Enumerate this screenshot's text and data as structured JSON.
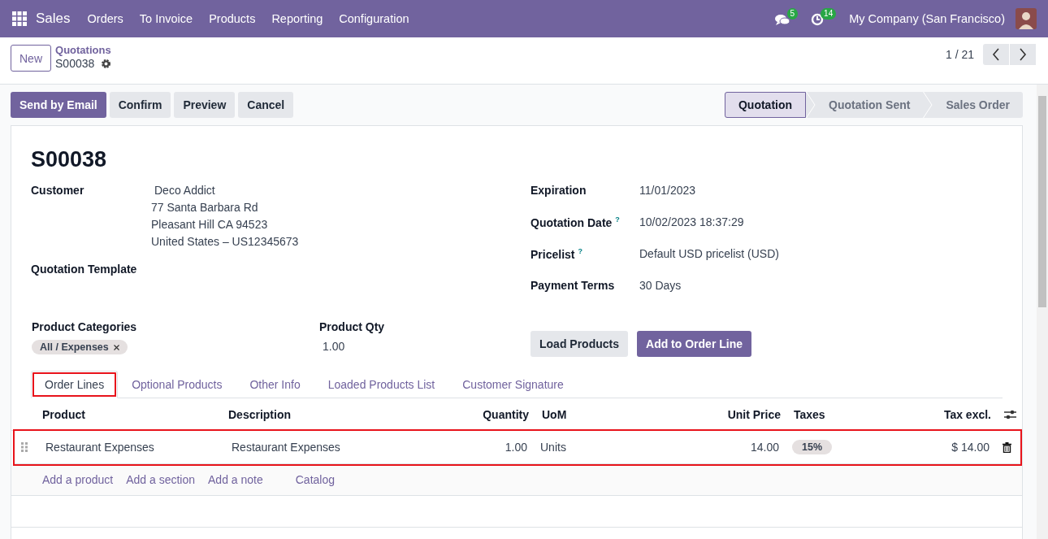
{
  "navbar": {
    "app": "Sales",
    "menu": [
      "Orders",
      "To Invoice",
      "Products",
      "Reporting",
      "Configuration"
    ],
    "messages_count": "5",
    "activities_count": "14",
    "company": "My Company (San Francisco)"
  },
  "control_panel": {
    "new_button": "New",
    "breadcrumb": "Quotations",
    "record": "S00038",
    "pager": "1 / 21"
  },
  "actions": [
    {
      "label": "Send by Email",
      "primary": true
    },
    {
      "label": "Confirm",
      "primary": false
    },
    {
      "label": "Preview",
      "primary": false
    },
    {
      "label": "Cancel",
      "primary": false
    }
  ],
  "status_stages": [
    {
      "label": "Quotation",
      "selected": true
    },
    {
      "label": "Quotation Sent",
      "selected": false
    },
    {
      "label": "Sales Order",
      "selected": false
    }
  ],
  "sheet": {
    "title": "S00038",
    "customer": {
      "label": "Customer",
      "name": "Deco Addict",
      "address": [
        "77 Santa Barbara Rd",
        "Pleasant Hill CA 94523",
        "United States – US12345673"
      ]
    },
    "template_label": "Quotation Template",
    "right_fields": [
      {
        "label": "Expiration",
        "value": "11/01/2023"
      },
      {
        "label": "Quotation Date $^{?}$",
        "value": "10/02/2023 18:37:29"
      },
      {
        "label": "Pricelist $^{?}$",
        "value": "Default USD pricelist (USD)"
      },
      {
        "label": "Payment Terms",
        "value": "30 Days"
      }
    ],
    "categories_label": "Product Categories",
    "category_tag": "All / Expenses",
    "qty_label": "Product Qty",
    "qty_value": "1.00",
    "buttons": [
      {
        "label": "Load Products",
        "primary": false
      },
      {
        "label": "Add to Order Line",
        "primary": true
      }
    ]
  },
  "tabs": [
    {
      "label": "Order Lines",
      "selected": true,
      "highlighted": true
    },
    {
      "label": "Optional Products",
      "selected": false,
      "highlighted": false
    },
    {
      "label": "Other Info",
      "selected": false,
      "highlighted": false
    },
    {
      "label": "Loaded Products List",
      "selected": false,
      "highlighted": false
    },
    {
      "label": "Customer Signature",
      "selected": false,
      "highlighted": false
    }
  ],
  "table": {
    "columns": [
      "Product",
      "Description",
      "Quantity",
      "UoM",
      "Unit Price",
      "Taxes",
      "Tax excl."
    ],
    "rows": [
      {
        "cells": [
          "Restaurant Expenses",
          "Restaurant Expenses",
          "1.00",
          "Units",
          "14.00",
          "15%",
          "$ 14.00"
        ],
        "highlighted": true
      }
    ],
    "add_links": [
      "Add a product",
      "Add a section",
      "Add a note",
      "Catalog"
    ]
  }
}
